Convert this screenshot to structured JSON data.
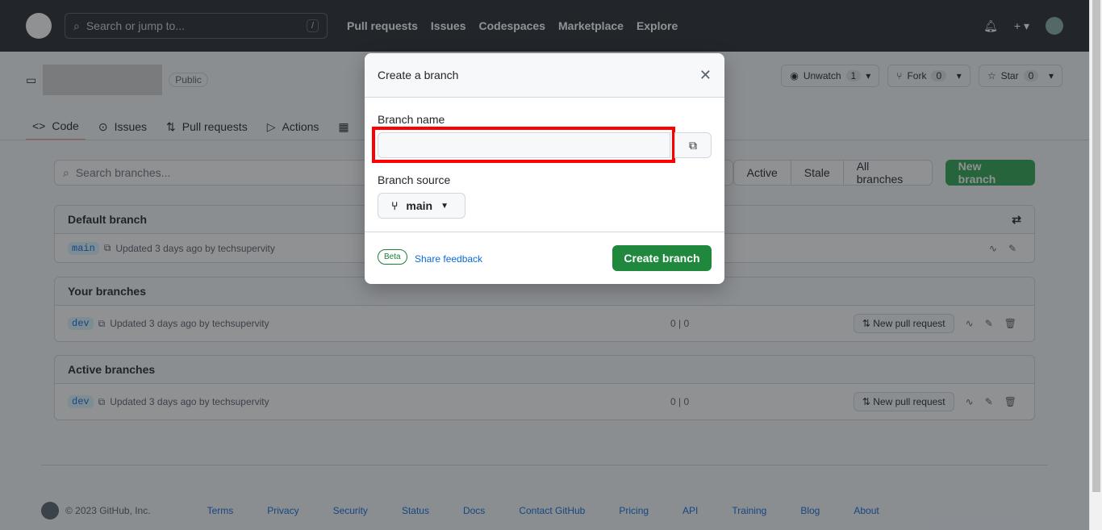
{
  "header": {
    "search_placeholder": "Search or jump to...",
    "slash": "/",
    "nav": [
      "Pull requests",
      "Issues",
      "Codespaces",
      "Marketplace",
      "Explore"
    ]
  },
  "repo": {
    "visibility": "Public",
    "watch": {
      "label": "Unwatch",
      "count": "1"
    },
    "fork": {
      "label": "Fork",
      "count": "0"
    },
    "star": {
      "label": "Star",
      "count": "0"
    }
  },
  "tabs": [
    "Code",
    "Issues",
    "Pull requests",
    "Actions"
  ],
  "branches": {
    "search_placeholder": "Search branches...",
    "filters": [
      "Active",
      "Stale",
      "All branches"
    ],
    "new_branch": "New branch",
    "sections": [
      {
        "title": "Default branch",
        "rows": [
          {
            "branch": "main",
            "updated": "Updated 3 days ago by techsupervity"
          }
        ]
      },
      {
        "title": "Your branches",
        "rows": [
          {
            "branch": "dev",
            "updated": "Updated 3 days ago by techsupervity",
            "behind": "0",
            "ahead": "0",
            "pr": "New pull request"
          }
        ]
      },
      {
        "title": "Active branches",
        "rows": [
          {
            "branch": "dev",
            "updated": "Updated 3 days ago by techsupervity",
            "behind": "0",
            "ahead": "0",
            "pr": "New pull request"
          }
        ]
      }
    ]
  },
  "footer": {
    "copyright": "© 2023 GitHub, Inc.",
    "links": [
      "Terms",
      "Privacy",
      "Security",
      "Status",
      "Docs",
      "Contact GitHub",
      "Pricing",
      "API",
      "Training",
      "Blog",
      "About"
    ]
  },
  "dialog": {
    "title": "Branch name",
    "heading": "Create a branch",
    "name_label": "Branch name",
    "name_value": "",
    "source_label": "Branch source",
    "source_value": "main",
    "beta": "Beta",
    "feedback": "Share feedback",
    "submit": "Create branch"
  },
  "colors": {
    "accent_green": "#1f883d",
    "highlight": "#ff0000"
  }
}
